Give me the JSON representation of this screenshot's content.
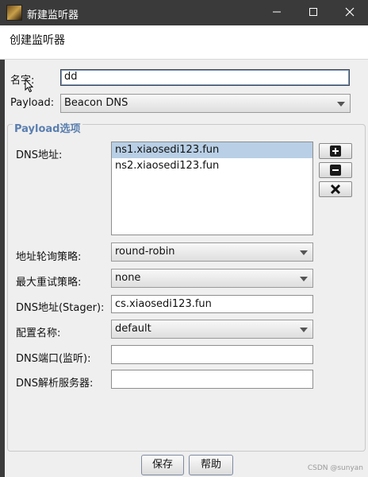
{
  "window": {
    "title": "新建监听器",
    "min_icon": "minimize-icon",
    "max_icon": "maximize-icon",
    "close_icon": "close-icon"
  },
  "header": {
    "heading": "创建监听器"
  },
  "form": {
    "name_label": "名字:",
    "name_value": "dd",
    "payload_label": "Payload:",
    "payload_value": "Beacon DNS"
  },
  "payload_options": {
    "group_title": "Payload选项",
    "dns_address_label": "DNS地址:",
    "dns_addresses": [
      "ns1.xiaosedi123.fun",
      "ns2.xiaosedi123.fun"
    ],
    "selected_index": 0,
    "rotation_label": "地址轮询策略:",
    "rotation_value": "round-robin",
    "retry_label": "最大重试策略:",
    "retry_value": "none",
    "stager_label": "DNS地址(Stager):",
    "stager_value": "cs.xiaosedi123.fun",
    "profile_label": "配置名称:",
    "profile_value": "default",
    "port_label": "DNS端口(监听):",
    "port_value": "",
    "resolver_label": "DNS解析服务器:",
    "resolver_value": ""
  },
  "buttons": {
    "save": "保存",
    "help": "帮助"
  },
  "watermark": "CSDN @sunyan",
  "colors": {
    "titlebar": "#3a3a3a",
    "group_title": "#5a7fb0",
    "selection": "#b8cfe5"
  }
}
